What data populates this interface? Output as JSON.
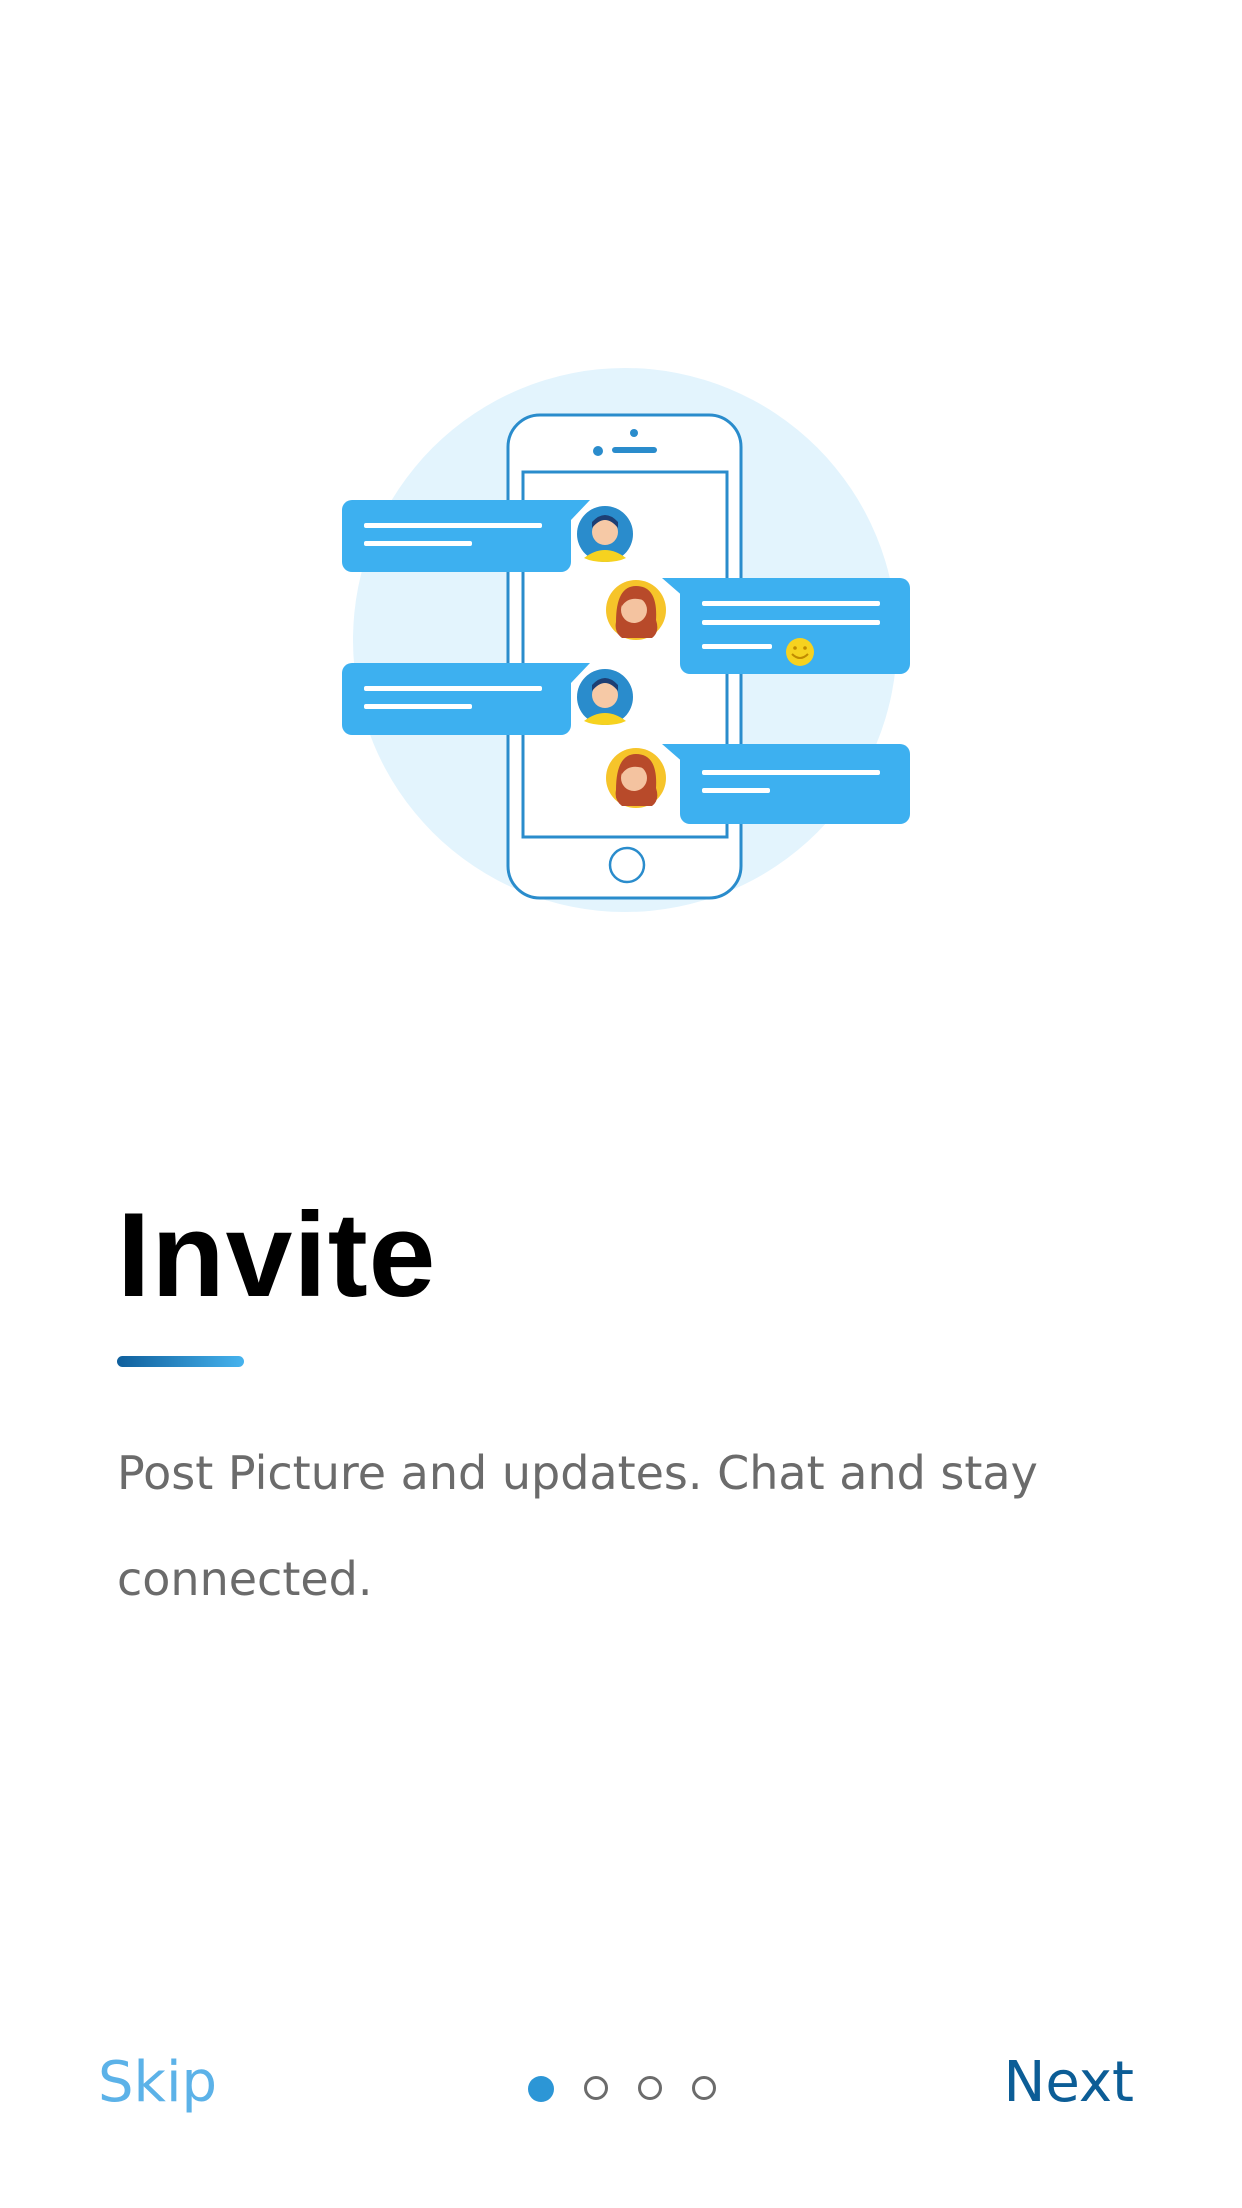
{
  "onboarding": {
    "title": "Invite",
    "description": "Post Picture and updates. Chat and stay connected.",
    "skip_label": "Skip",
    "next_label": "Next",
    "current_page": 1,
    "total_pages": 4
  },
  "colors": {
    "accent": "#3db0f0",
    "accent_dark": "#0c5d96",
    "skip": "#5cb2e8",
    "circle_bg": "#e3f4fd",
    "text_body": "#6b6b6b"
  },
  "icons": {
    "illustration": "phone-chat-illustration",
    "emoji": "smiley-emoji-icon"
  }
}
